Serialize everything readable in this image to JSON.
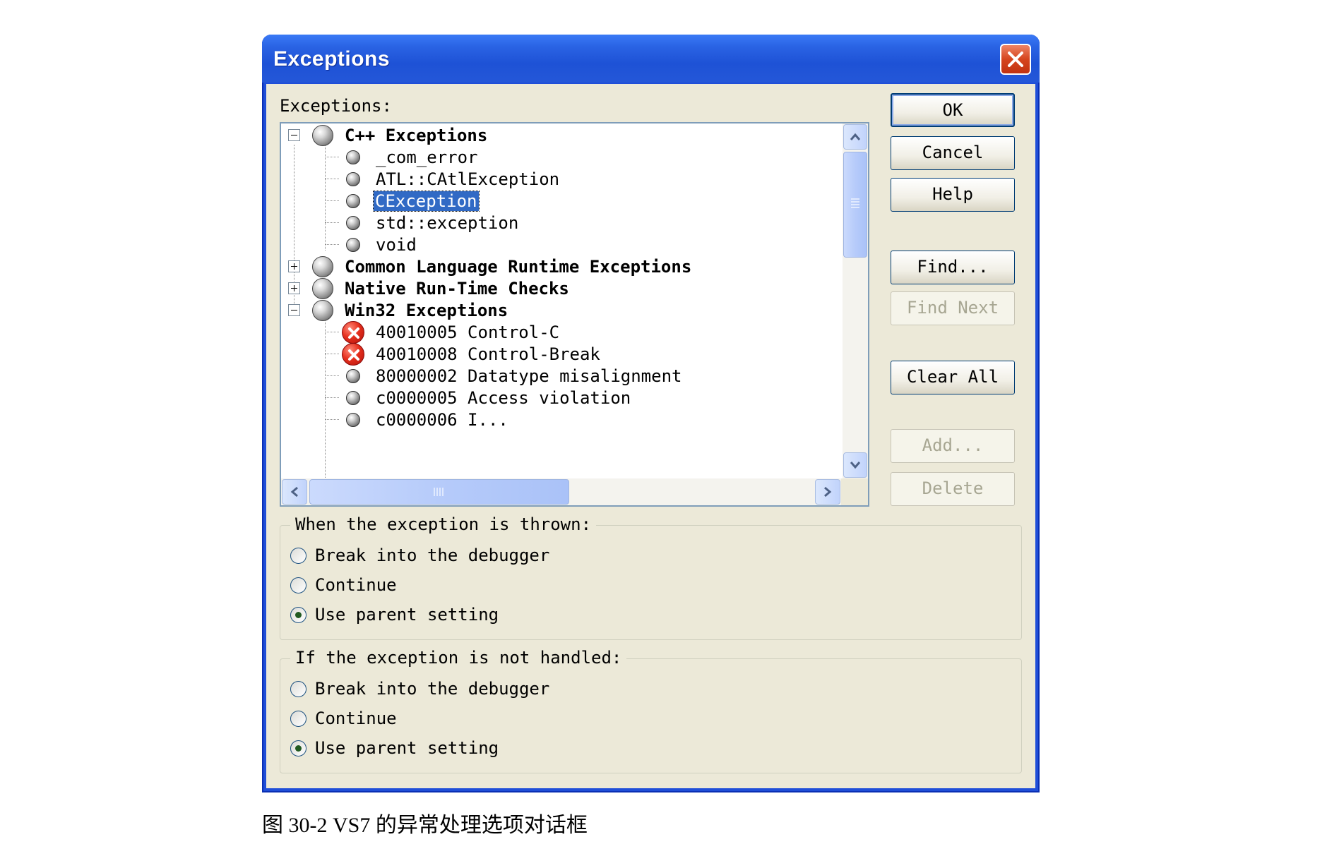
{
  "dialog": {
    "title": "Exceptions",
    "exceptions_label": "Exceptions:",
    "tree": [
      {
        "label": "C++ Exceptions",
        "kind": "category",
        "expanded": true,
        "icon": "gray-circle-icon"
      },
      {
        "label": "_com_error",
        "kind": "item",
        "icon": "gray-circle-icon"
      },
      {
        "label": "ATL::CAtlException",
        "kind": "item",
        "icon": "gray-circle-icon"
      },
      {
        "label": "CException",
        "kind": "item",
        "selected": true,
        "icon": "gray-circle-icon"
      },
      {
        "label": "std::exception",
        "kind": "item",
        "icon": "gray-circle-icon"
      },
      {
        "label": "void",
        "kind": "item",
        "icon": "gray-circle-icon"
      },
      {
        "label": "Common Language Runtime Exceptions",
        "kind": "category",
        "expanded": false,
        "icon": "gray-circle-icon"
      },
      {
        "label": "Native Run-Time Checks",
        "kind": "category",
        "expanded": false,
        "icon": "gray-circle-icon"
      },
      {
        "label": "Win32 Exceptions",
        "kind": "category",
        "expanded": true,
        "icon": "gray-circle-icon"
      },
      {
        "label": "40010005 Control-C",
        "kind": "item",
        "icon": "red-x-icon"
      },
      {
        "label": "40010008 Control-Break",
        "kind": "item",
        "icon": "red-x-icon"
      },
      {
        "label": "80000002 Datatype misalignment",
        "kind": "item",
        "icon": "gray-circle-icon"
      },
      {
        "label": "c0000005 Access violation",
        "kind": "item",
        "icon": "gray-circle-icon"
      },
      {
        "label": "c0000006 I...",
        "kind": "item",
        "icon": "gray-circle-icon",
        "partial": true
      }
    ],
    "buttons": {
      "ok": "OK",
      "cancel": "Cancel",
      "help": "Help",
      "find": "Find...",
      "find_next": "Find Next",
      "clear_all": "Clear All",
      "add": "Add...",
      "delete": "Delete"
    },
    "thrown_group": {
      "legend": "When the exception is thrown:",
      "options": [
        "Break into the debugger",
        "Continue",
        "Use parent setting"
      ],
      "selected": "Use parent setting"
    },
    "not_handled_group": {
      "legend": "If the exception is not handled:",
      "options": [
        "Break into the debugger",
        "Continue",
        "Use parent setting"
      ],
      "selected": "Use parent setting"
    }
  },
  "caption": "图 30-2 VS7 的异常处理选项对话框",
  "colors": {
    "titlebar": "#2a63e4",
    "selection": "#316ac5",
    "face": "#ece9d8",
    "close_button": "#d6451e"
  }
}
